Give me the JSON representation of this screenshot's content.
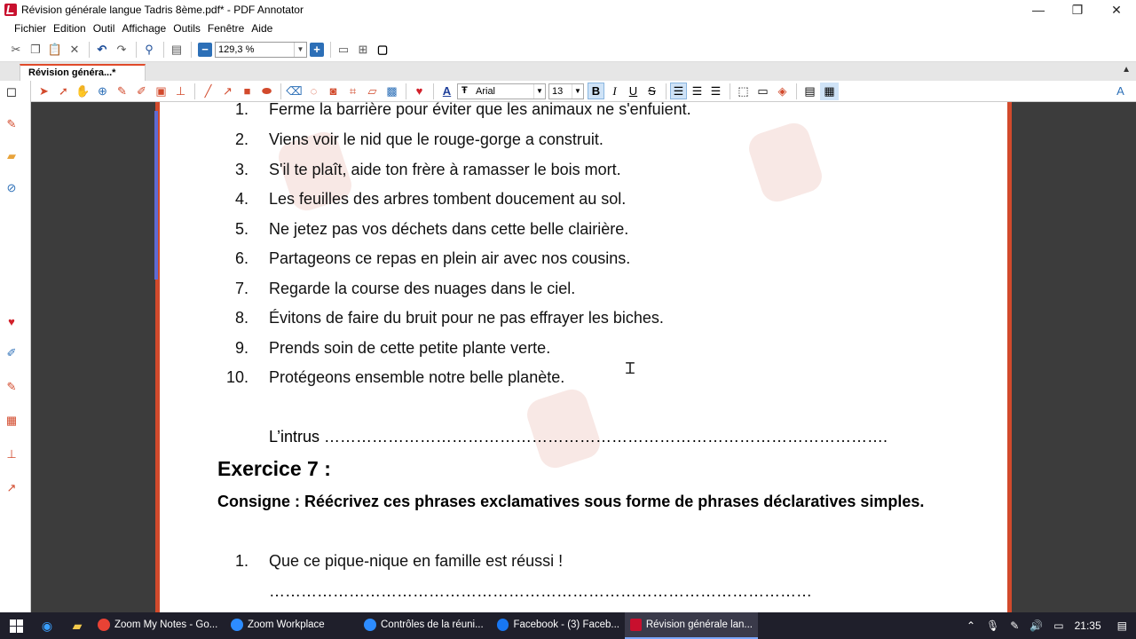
{
  "window": {
    "title": "Révision générale langue Tadris 8ème.pdf* - PDF Annotator",
    "minimize": "—",
    "restore": "❐",
    "close": "✕"
  },
  "menu": [
    "Fichier",
    "Edition",
    "Outil",
    "Affichage",
    "Outils",
    "Fenêtre",
    "Aide"
  ],
  "toolbar": {
    "zoom_value": "129,3 %"
  },
  "tabs": [
    {
      "label": "Révision généra...*"
    }
  ],
  "annotation_toolbar": {
    "font_name": "Arial",
    "font_size": "13",
    "bold": "B",
    "italic": "I",
    "underline": "U",
    "strike": "S",
    "text_color_letter": "A",
    "font_glyph": "Ŧ"
  },
  "document": {
    "items": [
      {
        "num": "1.",
        "text": "Ferme la barrière pour éviter que les animaux ne s'enfuient."
      },
      {
        "num": "2.",
        "text": "Viens voir le nid que le rouge-gorge a construit."
      },
      {
        "num": "3.",
        "text": "S'il te plaît, aide ton frère à ramasser le bois mort."
      },
      {
        "num": "4.",
        "text": "Les feuilles des arbres tombent doucement au sol."
      },
      {
        "num": "5.",
        "text": "Ne jetez pas vos déchets dans cette belle clairière."
      },
      {
        "num": "6.",
        "text": "Partageons ce repas en plein air avec nos cousins."
      },
      {
        "num": "7.",
        "text": "Regarde la course des nuages dans le ciel."
      },
      {
        "num": "8.",
        "text": "Évitons de faire du bruit pour ne pas effrayer les biches."
      },
      {
        "num": "9.",
        "text": "Prends soin de cette petite plante verte."
      },
      {
        "num": "10.",
        "text": "Protégeons ensemble notre belle planète."
      }
    ],
    "intrus": "L’intrus …………………………………………………………………………………………….",
    "exercise_title": "Exercice 7 :",
    "consigne": "Consigne : Réécrivez ces phrases exclamatives sous forme de phrases déclaratives simples.",
    "ex7_items": [
      {
        "num": "1.",
        "text": "Que ce pique-nique en famille est réussi !"
      }
    ],
    "answer_line": "…………………………………………………………………………………………"
  },
  "taskbar": {
    "apps": [
      {
        "label": "Zoom My Notes - Go...",
        "color": "#e94235"
      },
      {
        "label": "Zoom Workplace",
        "color": "#2d8cff"
      },
      {
        "label": "Contrôles de la réuni...",
        "color": "#2d8cff"
      },
      {
        "label": "Facebook - (3) Faceb...",
        "color": "#1877f2"
      },
      {
        "label": "Révision générale lan...",
        "color": "#c8102e"
      }
    ],
    "time": "21:35"
  },
  "colors": {
    "page_border": "#d24a2c",
    "tab_accent": "#e04a2a",
    "taskbar_bg": "#1f1f2b"
  }
}
